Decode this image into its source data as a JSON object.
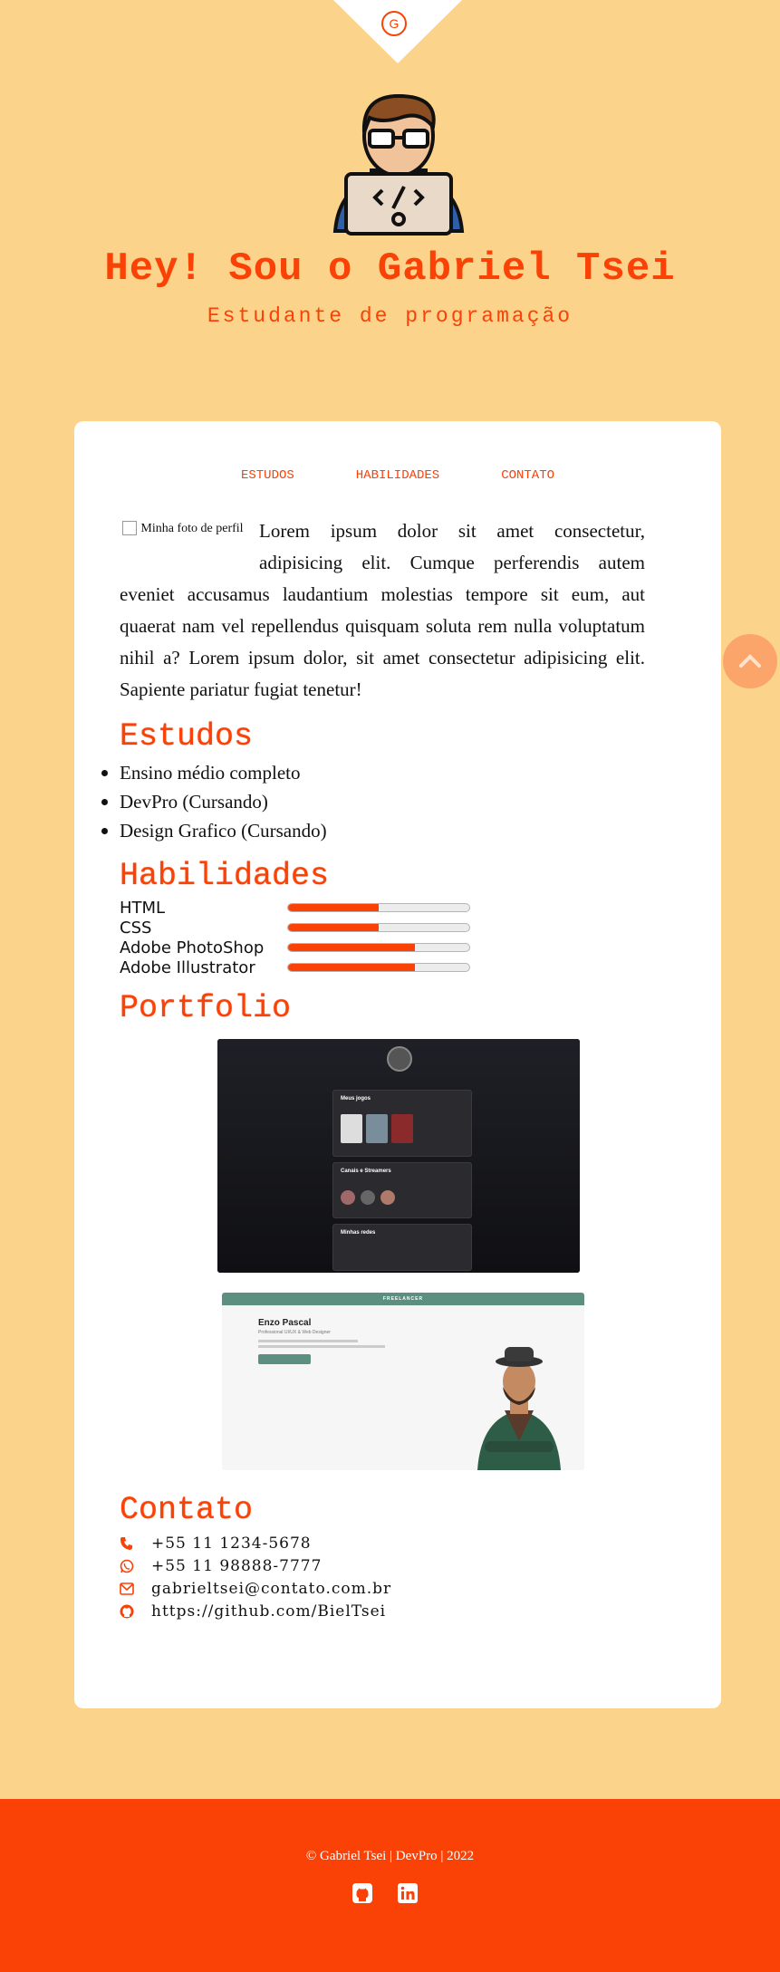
{
  "header": {
    "logo_letter": "G",
    "title": "Hey! Sou o Gabriel Tsei",
    "subtitle": "Estudante de programação"
  },
  "nav": {
    "items": [
      "ESTUDOS",
      "HABILIDADES",
      "CONTATO"
    ]
  },
  "about": {
    "photo_alt": "Minha foto de perfil",
    "text": "Lorem ipsum dolor sit amet consectetur, adipisicing elit. Cumque perferendis autem eveniet accusamus laudantium molestias tempore sit eum, aut quaerat nam vel repellendus quisquam soluta rem nulla voluptatum nihil a? Lorem ipsum dolor, sit amet consectetur adipisicing elit. Sapiente pariatur fugiat tenetur!"
  },
  "studies": {
    "title": "Estudos",
    "items": [
      "Ensino médio completo",
      "DevPro (Cursando)",
      "Design Grafico (Cursando)"
    ]
  },
  "skills": {
    "title": "Habilidades",
    "items": [
      {
        "name": "HTML",
        "level": 0.5
      },
      {
        "name": "CSS",
        "level": 0.5
      },
      {
        "name": "Adobe PhotoShop",
        "level": 0.7
      },
      {
        "name": "Adobe Illustrator",
        "level": 0.7
      }
    ]
  },
  "portfolio": {
    "title": "Portfolio",
    "project1": {
      "cards": [
        "Meus jogos",
        "Canais e Streamers",
        "Minhas redes"
      ]
    },
    "project2": {
      "banner": "FREELANCER",
      "name": "Enzo Pascal",
      "role": "Professional UI/UX & Web Designer"
    }
  },
  "contact": {
    "title": "Contato",
    "items": [
      {
        "icon": "phone-icon",
        "text": "+55 11 1234-5678"
      },
      {
        "icon": "whatsapp-icon",
        "text": "+55 11 98888-7777"
      },
      {
        "icon": "email-icon",
        "text": "gabrieltsei@contato.com.br"
      },
      {
        "icon": "github-icon",
        "text": "https://github.com/BielTsei"
      }
    ]
  },
  "footer": {
    "copyright": "© Gabriel Tsei | DevPro | 2022"
  },
  "colors": {
    "accent": "#fa4106",
    "background": "#fcd38a",
    "card": "#ffffff",
    "scroll_button": "#fca56a"
  }
}
